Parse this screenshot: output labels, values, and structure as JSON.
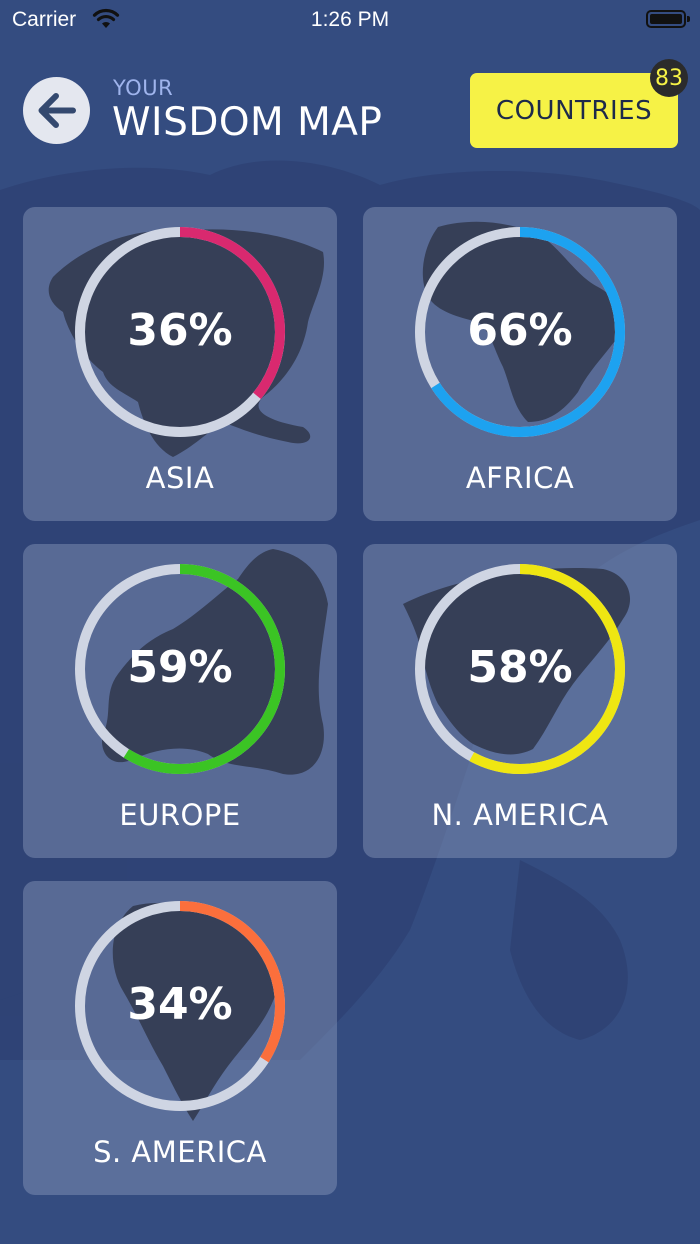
{
  "status_bar": {
    "carrier": "Carrier",
    "time": "1:26 PM"
  },
  "header": {
    "subtitle": "YOUR",
    "title": "WISDOM MAP"
  },
  "countries_button": {
    "label": "COUNTRIES",
    "badge": "83"
  },
  "continents": [
    {
      "name": "ASIA",
      "percent_label": "36%",
      "progress": 0.36,
      "color": "#d9296f"
    },
    {
      "name": "AFRICA",
      "percent_label": "66%",
      "progress": 0.66,
      "color": "#1da2f0"
    },
    {
      "name": "EUROPE",
      "percent_label": "59%",
      "progress": 0.59,
      "color": "#3bc424"
    },
    {
      "name": "N. AMERICA",
      "percent_label": "58%",
      "progress": 0.58,
      "color": "#efe612"
    },
    {
      "name": "S. AMERICA",
      "percent_label": "34%",
      "progress": 0.34,
      "color": "#fb6f3c"
    }
  ],
  "colors": {
    "background": "#344c80",
    "ring_track": "#cfd5e3",
    "accent_button": "#f6f246"
  },
  "icons": {
    "back": "arrow-left-icon",
    "wifi": "wifi-icon",
    "battery": "battery-icon"
  }
}
